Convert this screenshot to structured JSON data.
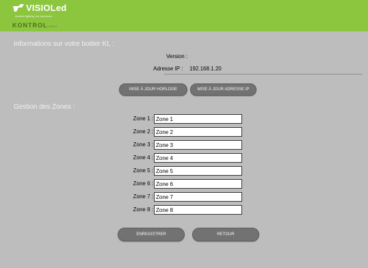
{
  "header": {
    "brand": "VISIOLed",
    "tagline": "Another lighting, the tomorrow...",
    "product": "KONTROL",
    "product_sub": "LIGHT"
  },
  "info": {
    "title": "Informations sur votre boitier KL :",
    "version_label": "Version :",
    "version_value": "",
    "ip_label": "Adresse IP :",
    "ip_value": "192.168.1.20"
  },
  "buttons": {
    "update_clock": "MISE À JOUR HORLOGE",
    "update_ip": "MISE À JOUR ADRESSE IP",
    "save": "ENREGISTRER",
    "back": "RETOUR"
  },
  "zones": {
    "title": "Gestion des Zones :",
    "items": [
      {
        "label": "Zone 1 :",
        "value": "Zone 1"
      },
      {
        "label": "Zone 2 :",
        "value": "Zone 2"
      },
      {
        "label": "Zone 3 :",
        "value": "Zone 3"
      },
      {
        "label": "Zone 4 :",
        "value": "Zone 4"
      },
      {
        "label": "Zone 5 :",
        "value": "Zone 5"
      },
      {
        "label": "Zone 6 :",
        "value": "Zone 6"
      },
      {
        "label": "Zone 7 :",
        "value": "Zone 7"
      },
      {
        "label": "Zone 8 :",
        "value": "Zone 8"
      }
    ]
  },
  "colors": {
    "header": "#8cc63f",
    "background": "#bdbdbd",
    "button": "#727272"
  }
}
